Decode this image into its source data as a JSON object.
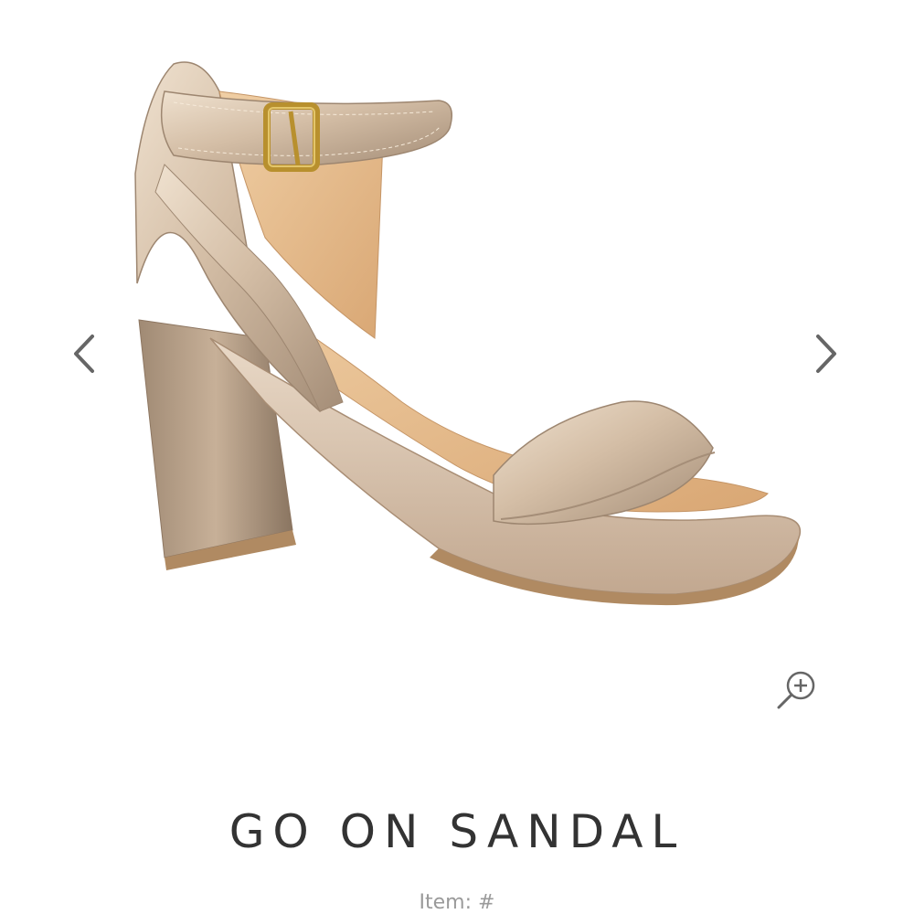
{
  "gallery": {
    "image_alt": "Gold metallic block-heel platform sandal with ankle strap",
    "prev_icon": "chevron-left-icon",
    "next_icon": "chevron-right-icon",
    "zoom_icon": "zoom-in-icon"
  },
  "product": {
    "title": "GO ON SANDAL",
    "item_label": "Item: #"
  },
  "colors": {
    "title": "#333333",
    "item": "#9a9a9a",
    "arrow": "#666666",
    "metallic_light": "#e8d6c2",
    "metallic_mid": "#c9b29a",
    "metallic_dark": "#8f7a66",
    "lining": "#e3b98a",
    "buckle": "#b8902e"
  }
}
